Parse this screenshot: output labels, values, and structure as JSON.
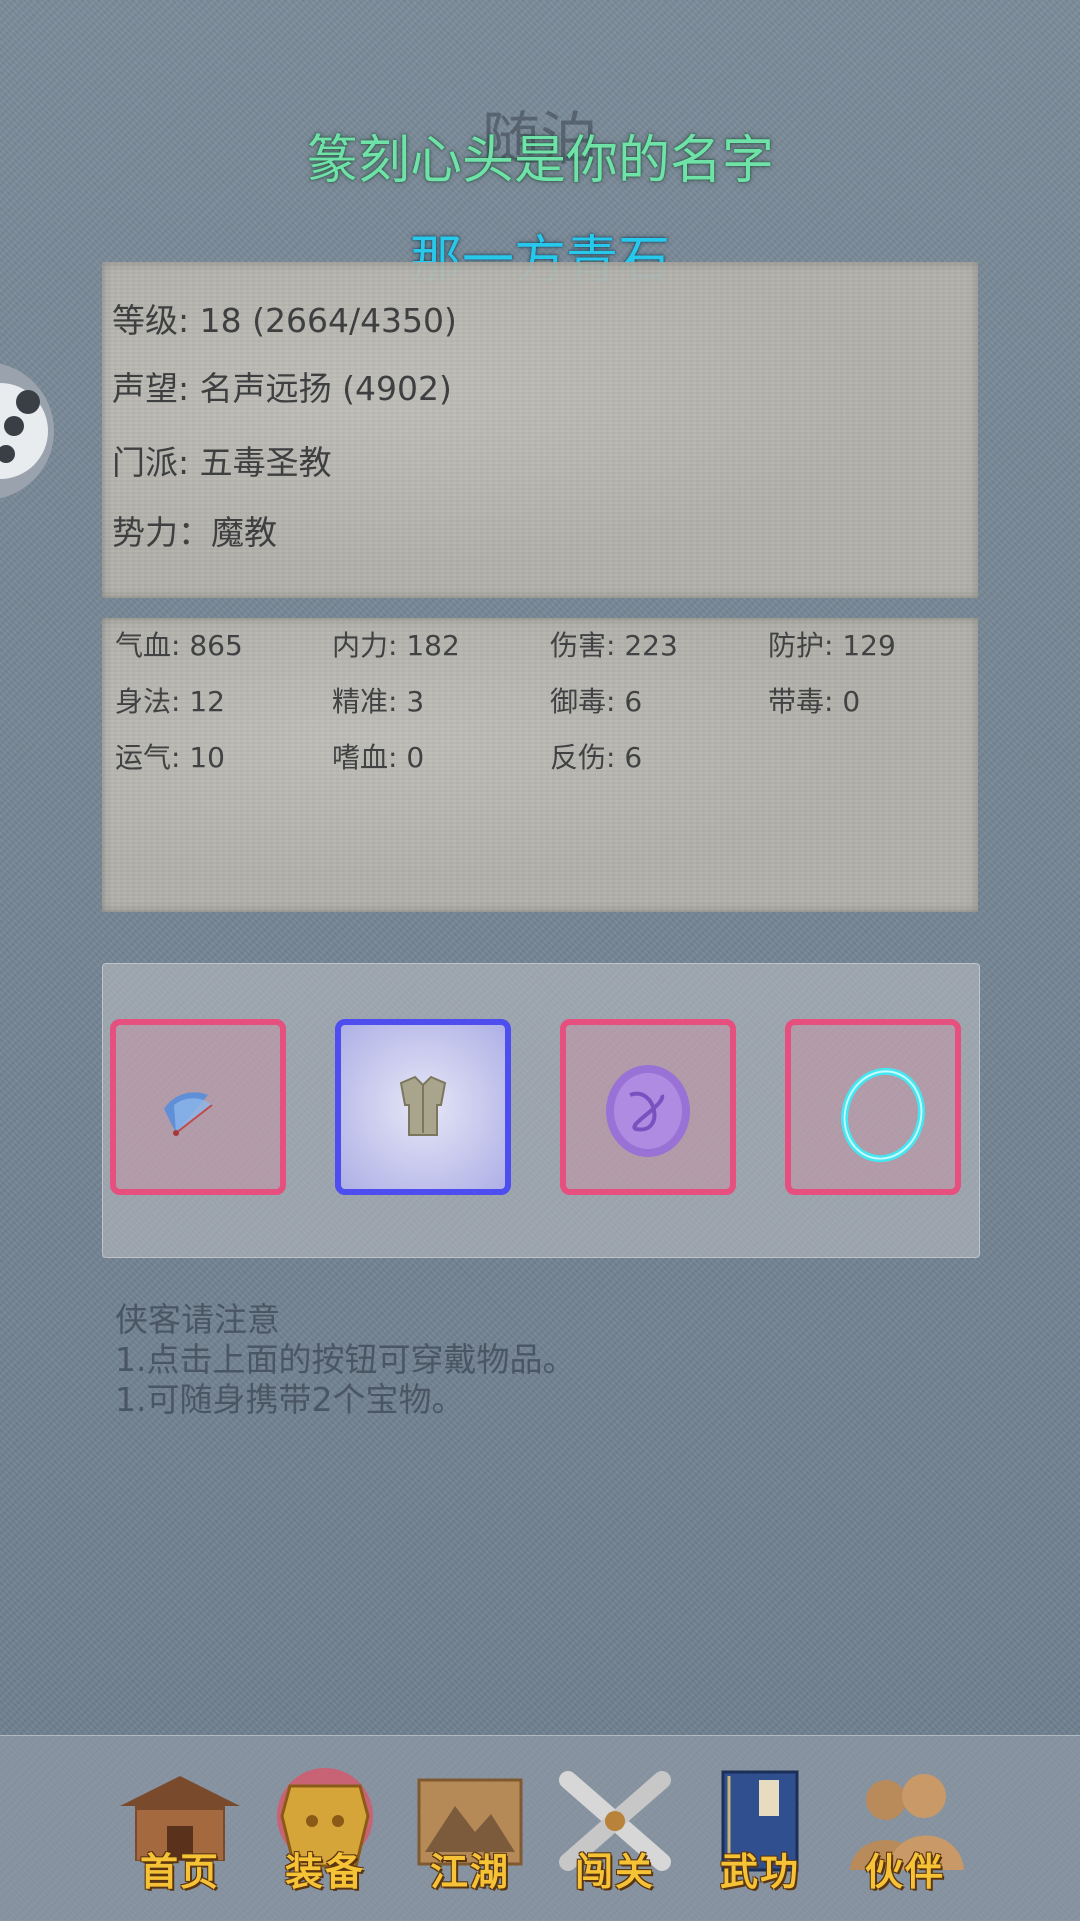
{
  "header": {
    "dim_title": "随泊",
    "title": "篆刻心头是你的名字",
    "subtitle": "那一方青石"
  },
  "info": {
    "level": "等级: 18 (2664/4350)",
    "reputation": "声望: 名声远扬 (4902)",
    "sect": "门派: 五毒圣教",
    "faction": "势力：魔教"
  },
  "stats": [
    [
      "气血: 865",
      "内力: 182",
      "伤害: 223",
      "防护: 129"
    ],
    [
      "身法: 12",
      "精准: 3",
      "御毒: 6",
      "带毒: 0"
    ],
    [
      "运气: 10",
      "嗜血: 0",
      "反伤: 6"
    ]
  ],
  "equipment": {
    "slots": [
      {
        "item": "fan-icon",
        "rarity_color": "#e6507f"
      },
      {
        "item": "robe-icon",
        "rarity_color": "#4d4df0"
      },
      {
        "item": "purple-token-icon",
        "rarity_color": "#e6507f"
      },
      {
        "item": "cyan-ring-icon",
        "rarity_color": "#e6507f"
      }
    ]
  },
  "notice": {
    "heading": "侠客请注意",
    "line1": "1.点击上面的按钮可穿戴物品。",
    "line2": "1.可随身携带2个宝物。"
  },
  "nav": {
    "home": "首页",
    "equip": "装备",
    "jianghu": "江湖",
    "stage": "闯关",
    "martial": "武功",
    "partner": "伙伴"
  }
}
